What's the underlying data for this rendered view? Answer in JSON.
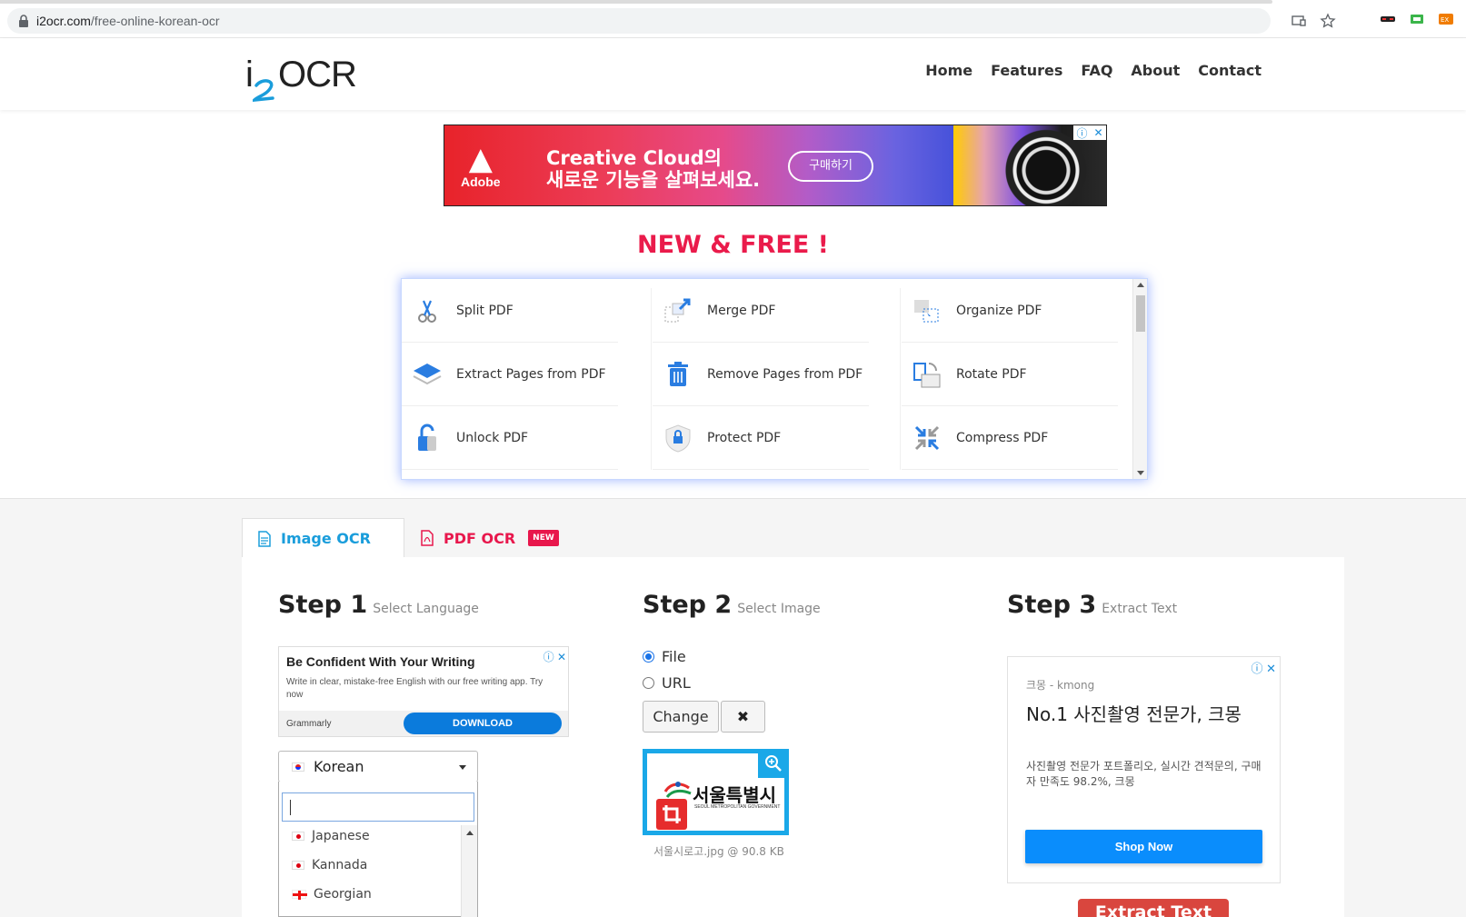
{
  "browser": {
    "url_domain": "i2ocr.com",
    "url_path": "/free-online-korean-ocr"
  },
  "header": {
    "logo_i": "i",
    "logo_text": "OCR",
    "nav": [
      "Home",
      "Features",
      "FAQ",
      "About",
      "Contact"
    ]
  },
  "banner_ad": {
    "brand": "Adobe",
    "headline_line1": "Creative Cloud의",
    "headline_line2": "새로운 기능을 살펴보세요.",
    "cta": "구매하기"
  },
  "promo_title": "NEW & FREE !",
  "tools": [
    {
      "label": "Split PDF",
      "icon": "scissors-icon"
    },
    {
      "label": "Merge PDF",
      "icon": "merge-icon"
    },
    {
      "label": "Organize PDF",
      "icon": "organize-icon"
    },
    {
      "label": "Extract Pages from PDF",
      "icon": "layers-icon"
    },
    {
      "label": "Remove Pages from PDF",
      "icon": "trash-icon"
    },
    {
      "label": "Rotate PDF",
      "icon": "rotate-icon"
    },
    {
      "label": "Unlock PDF",
      "icon": "unlock-icon"
    },
    {
      "label": "Protect PDF",
      "icon": "shield-lock-icon"
    },
    {
      "label": "Compress PDF",
      "icon": "compress-icon"
    }
  ],
  "tabs": {
    "image_ocr": "Image OCR",
    "pdf_ocr": "PDF OCR",
    "new_badge": "NEW"
  },
  "step1": {
    "title": "Step 1",
    "subtitle": "Select Language",
    "ad": {
      "title": "Be Confident With Your Writing",
      "desc": "Write in clear, mistake-free English with our free writing app. Try now",
      "brand": "Grammarly",
      "button": "DOWNLOAD"
    },
    "selected_language": "Korean",
    "search_value": "",
    "options": [
      "Japanese",
      "Kannada",
      "Georgian"
    ]
  },
  "step2": {
    "title": "Step 2",
    "subtitle": "Select Image",
    "radio_file": "File",
    "radio_url": "URL",
    "selected_source": "File",
    "change_button": "Change",
    "remove_button": "✖",
    "preview_text": "서울특별시",
    "preview_subtext": "SEOUL METROPOLITAN GOVERNMENT",
    "file_caption": "서울시로고.jpg @ 90.8 KB"
  },
  "step3": {
    "title": "Step 3",
    "subtitle": "Extract Text",
    "ad": {
      "source": "크몽 - kmong",
      "headline": "No.1 사진촬영 전문가, 크몽",
      "desc": "사진촬영 전문가 포트폴리오, 실시간 견적문의, 구매자 만족도 98.2%, 크몽",
      "button": "Shop Now"
    },
    "extract_button": "Extract Text"
  },
  "colors": {
    "accent_blue": "#1a9ddb",
    "accent_red": "#e8174c",
    "extract_red": "#d9463e"
  }
}
